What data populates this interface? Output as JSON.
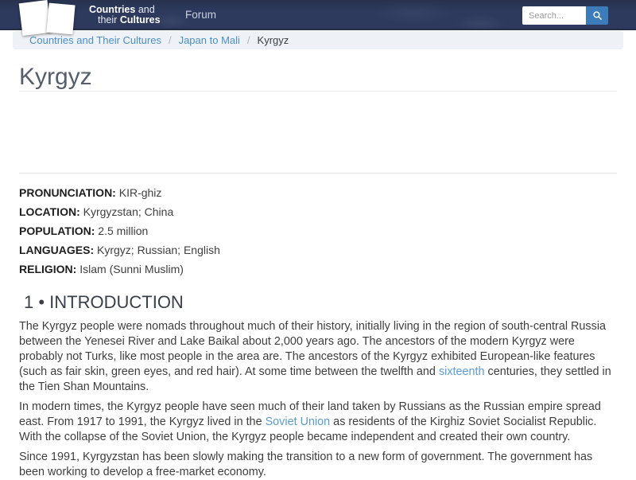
{
  "header": {
    "brand": {
      "word1": "Countries",
      "word2": "and",
      "word3": "their",
      "word4": "Cultures"
    },
    "forum_label": "Forum",
    "search": {
      "placeholder": "Search...",
      "icon": "magnifier-icon"
    }
  },
  "breadcrumb": {
    "links": [
      "Countries and Their Cultures",
      "Japan to Mali"
    ],
    "separator": "/",
    "current": "Kyrgyz"
  },
  "article": {
    "title": "Kyrgyz",
    "facts": [
      {
        "label": "PRONUNCIATION:",
        "value": "KIR-ghiz"
      },
      {
        "label": "LOCATION:",
        "value": "Kyrgyzstan; China"
      },
      {
        "label": "POPULATION:",
        "value": "2.5 million"
      },
      {
        "label": "LANGUAGES:",
        "value": "Kyrgyz; Russian; English"
      },
      {
        "label": "RELIGION:",
        "value": "Islam (Sunni Muslim)"
      }
    ],
    "section_heading": "1 • INTRODUCTION",
    "paragraphs": [
      {
        "pre": "The Kyrgyz people were nomads throughout much of their history, initially living in the region of south-central Russia between the Yenesei River and Lake Baikal about 2,000 years ago. The ancestors of the modern Kyrgyz were probably not Turks, like most people in the area are. The ancestors of the Kyrgyz exhibited European-like features (such as fair skin, green eyes, and red hair). At some time between the twelfth and ",
        "link_text": "sixteenth",
        "post": " centuries, they settled in the Tien Shan Mountains."
      },
      {
        "pre": "In modern times, the Kyrgyz people have seen much of their land taken by Russians as the Russian empire spread east. From 1917 to 1991, the Kyrgyz lived in the ",
        "link_text": "Soviet Union",
        "post": " as residents of the Kirghiz Soviet Socialist Republic. With the collapse of the Soviet Union, the Kyrgyz people became independent and created their own country."
      },
      {
        "text": "Since 1991, Kyrgyzstan has been slowly making the transition to a new form of government. The government has been working to develop a free-market economy."
      }
    ]
  },
  "colors": {
    "header_bg": "#2d3a5e",
    "header_border": "#232d46",
    "breadcrumb_bg": "#eef1f5",
    "link_blue": "#4a8fc7",
    "text_link_blue": "#5b9bd1",
    "body_text": "#3e3e3e",
    "title_text": "#565e6c",
    "heading_text": "#39404b",
    "search_button": "#3d7cba"
  }
}
